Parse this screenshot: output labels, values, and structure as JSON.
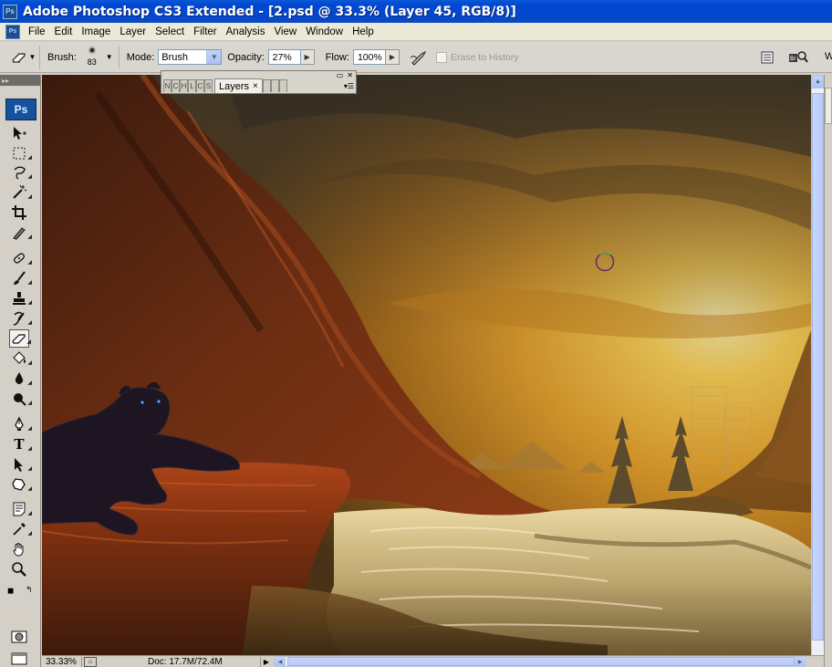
{
  "window": {
    "title": "Adobe Photoshop CS3 Extended - [2.psd @ 33.3% (Layer 45, RGB/8)]",
    "app_icon": "Ps"
  },
  "menubar": {
    "app_icon": "Ps",
    "items": [
      "File",
      "Edit",
      "Image",
      "Layer",
      "Select",
      "Filter",
      "Analysis",
      "View",
      "Window",
      "Help"
    ]
  },
  "options": {
    "tool_icon": "eraser-icon",
    "brush_label": "Brush:",
    "brush_size": "83",
    "mode_label": "Mode:",
    "mode_value": "Brush",
    "opacity_label": "Opacity:",
    "opacity_value": "27%",
    "flow_label": "Flow:",
    "flow_value": "100%",
    "erase_to_history_label": "Erase to History",
    "erase_to_history_checked": false,
    "right_cutoff_text": "W"
  },
  "dock": {
    "mini_tabs": [
      "N",
      "C",
      "H",
      "L",
      "C",
      "S",
      "",
      "",
      "",
      ""
    ],
    "active_tab_label": "Layers",
    "close_glyph": "×"
  },
  "toolbox": {
    "badge": "Ps",
    "tools": [
      {
        "name": "move-tool",
        "icon": "move-icon"
      },
      {
        "name": "marquee-tool",
        "icon": "rect-marquee-icon"
      },
      {
        "name": "lasso-tool",
        "icon": "lasso-icon"
      },
      {
        "name": "magic-wand-tool",
        "icon": "magic-wand-icon"
      },
      {
        "name": "crop-tool",
        "icon": "crop-icon"
      },
      {
        "name": "eyedropper-slice-tool",
        "icon": "slice-icon"
      },
      {
        "name": "healing-brush-tool",
        "icon": "healing-brush-icon"
      },
      {
        "name": "brush-tool",
        "icon": "brush-icon"
      },
      {
        "name": "clone-stamp-tool",
        "icon": "stamp-icon"
      },
      {
        "name": "history-brush-tool",
        "icon": "history-brush-icon"
      },
      {
        "name": "eraser-tool",
        "icon": "eraser-icon",
        "active": true
      },
      {
        "name": "paint-bucket-tool",
        "icon": "bucket-icon"
      },
      {
        "name": "blur-tool",
        "icon": "drop-icon"
      },
      {
        "name": "dodge-tool",
        "icon": "dodge-icon"
      },
      {
        "name": "pen-tool",
        "icon": "pen-icon"
      },
      {
        "name": "type-tool",
        "icon": "type-icon",
        "glyph": "T"
      },
      {
        "name": "path-selection-tool",
        "icon": "arrow-icon"
      },
      {
        "name": "custom-shape-tool",
        "icon": "shape-icon"
      },
      {
        "name": "notes-tool",
        "icon": "note-icon"
      },
      {
        "name": "eyedropper-tool",
        "icon": "eyedropper-icon"
      },
      {
        "name": "hand-tool",
        "icon": "hand-icon"
      },
      {
        "name": "zoom-tool",
        "icon": "zoom-icon"
      }
    ],
    "foreground_color": "#000000",
    "background_color": "#6a5e3a"
  },
  "status": {
    "zoom": "33.33%",
    "doc_info": "Doc: 17.7M/72.4M"
  },
  "colors": {
    "title_blue": "#0247d3",
    "chrome": "#d4d0c8",
    "menu_bg": "#ece9d8"
  }
}
